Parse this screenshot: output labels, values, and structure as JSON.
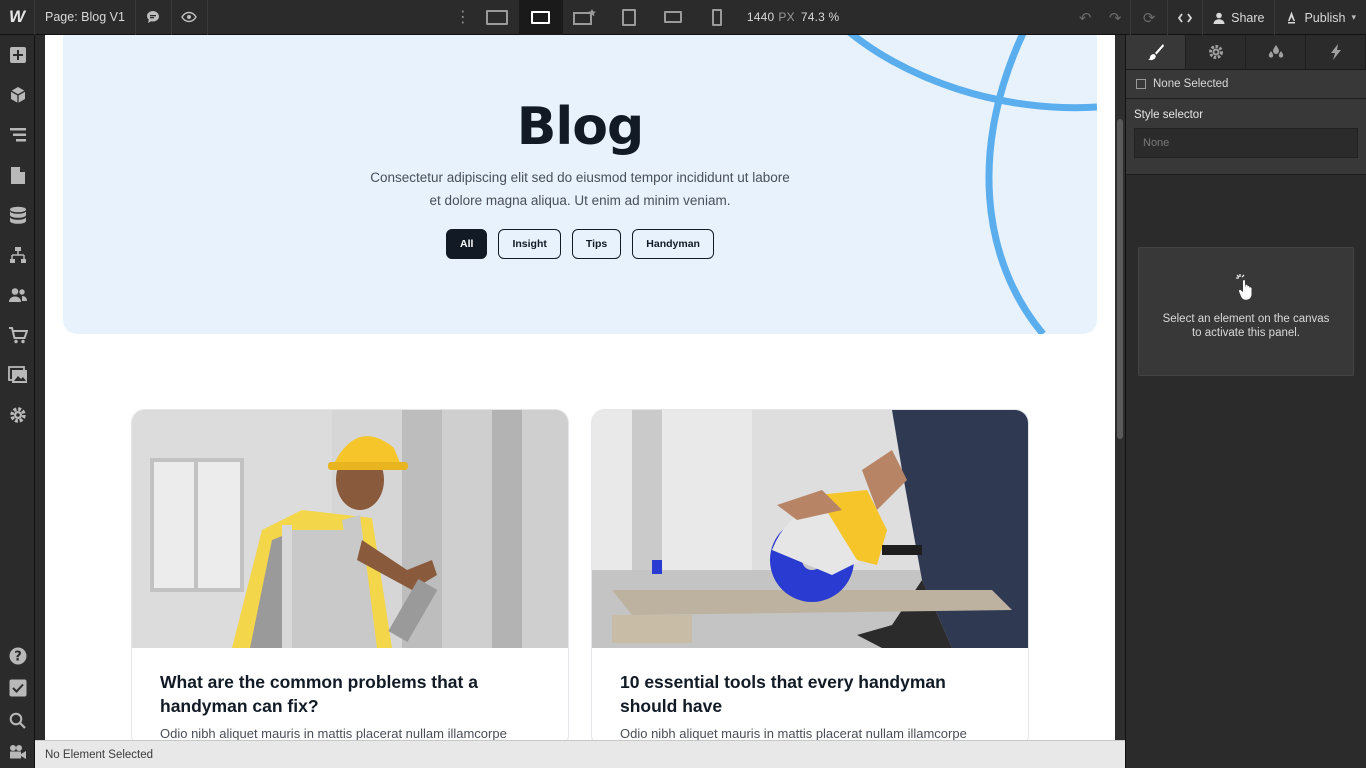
{
  "topbar": {
    "logo": "W",
    "page_label": "Page: Blog V1",
    "width_value": "1440",
    "width_unit": "PX",
    "zoom": "74.3 %",
    "share_label": "Share",
    "publish_label": "Publish"
  },
  "hero": {
    "title": "Blog",
    "subtitle": "Consectetur adipiscing elit sed do eiusmod tempor incididunt ut labore et dolore magna aliqua. Ut enim ad minim veniam.",
    "filters": [
      "All",
      "Insight",
      "Tips",
      "Handyman"
    ],
    "accent": "#5aaeee"
  },
  "cards": [
    {
      "title": "What are the common problems that a handyman can fix?",
      "excerpt": "Odio nibh aliquet mauris in mattis placerat nullam illamcorpe"
    },
    {
      "title": "10 essential tools that every handyman should have",
      "excerpt": "Odio nibh aliquet mauris in mattis placerat nullam illamcorpe"
    }
  ],
  "statusbar": {
    "text": "No Element Selected"
  },
  "rightpanel": {
    "none_selected": "None Selected",
    "style_selector_label": "Style selector",
    "style_selector_placeholder": "None",
    "empty_message": "Select an element on the canvas to activate this panel."
  }
}
